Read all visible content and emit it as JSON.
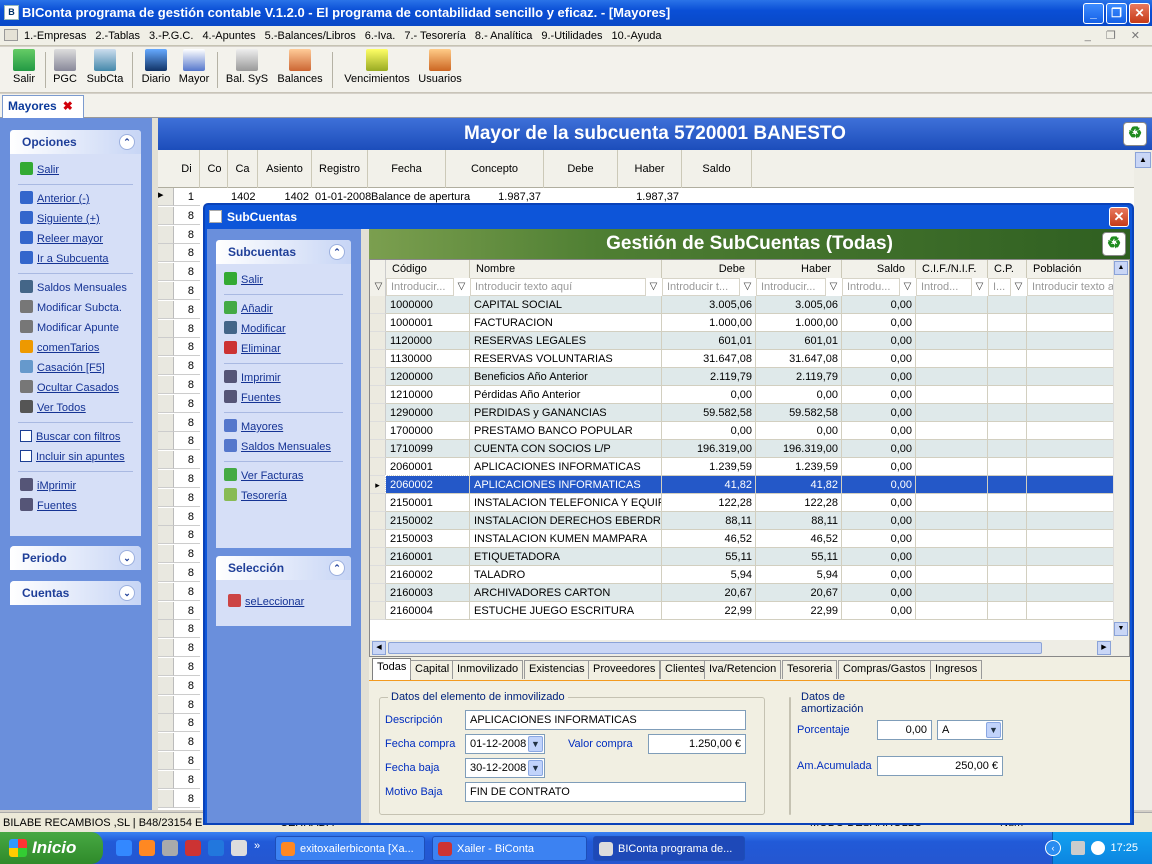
{
  "window": {
    "title": "BIConta programa de gestión contable V.1.2.0 - El programa de contabilidad sencillo y eficaz. - [Mayores]"
  },
  "menu": [
    "1.-Empresas",
    "2.-Tablas",
    "3.-P.G.C.",
    "4.-Apuntes",
    "5.-Balances/Libros",
    "6.-Iva.",
    "7.- Tesorería",
    "8.- Analítica",
    "9.-Utilidades",
    "10.-Ayuda"
  ],
  "toolbar": {
    "salir": "Salir",
    "pgc": "PGC",
    "subcta": "SubCta",
    "diario": "Diario",
    "mayor": "Mayor",
    "balsys": "Bal. SyS",
    "balances": "Balances",
    "vencimientos": "Vencimientos",
    "usuarios": "Usuarios"
  },
  "doc_tab": {
    "label": "Mayores"
  },
  "left": {
    "opciones": {
      "title": "Opciones",
      "items": [
        "Salir",
        "Anterior (-)",
        "Siguiente (+)",
        "Releer mayor",
        "Ir a Subcuenta",
        "Saldos Mensuales",
        "Modificar Subcta.",
        "Modificar Apunte",
        "comenTarios",
        "Casación [F5]",
        "Ocultar Casados",
        "Ver Todos",
        "Buscar con filtros",
        "Incluir sin apuntes",
        "iMprimir",
        "Fuentes"
      ]
    },
    "periodo": {
      "title": "Periodo"
    },
    "cuentas": {
      "title": "Cuentas"
    }
  },
  "mayor": {
    "title": "Mayor de la subcuenta 5720001 BANESTO",
    "columns": [
      "Di",
      "Co",
      "Ca",
      "Asiento",
      "Registro",
      "Fecha",
      "Concepto",
      "Debe",
      "Haber",
      "Saldo"
    ],
    "first_row": {
      "di": "1",
      "asiento": "1402",
      "registro": "1402",
      "fecha": "01-01-2008",
      "concepto": "Balance de apertura",
      "debe": "1.987,37",
      "saldo": "1.987,37"
    },
    "other_di": "8"
  },
  "dialog": {
    "title": "SubCuentas",
    "side": {
      "subcuentas": {
        "title": "Subcuentas",
        "items": [
          "Salir",
          "Añadir",
          "Modificar",
          "Eliminar",
          "Imprimir",
          "Fuentes",
          "Mayores",
          "Saldos Mensuales",
          "Ver Facturas",
          "Tesorería"
        ]
      },
      "seleccion": {
        "title": "Selección",
        "items": [
          "seLeccionar"
        ]
      }
    },
    "grid_title": "Gestión de SubCuentas (Todas)",
    "columns": [
      "Código",
      "Nombre",
      "Debe",
      "Haber",
      "Saldo",
      "C.I.F./N.I.F.",
      "C.P.",
      "Población"
    ],
    "filters": [
      "Introducir...",
      "Introducir texto aquí",
      "Introducir t...",
      "Introducir...",
      "Introdu...",
      "Introd...",
      "I...",
      "Introducir texto aq"
    ],
    "rows": [
      [
        "1000000",
        "CAPITAL SOCIAL",
        "3.005,06",
        "3.005,06",
        "0,00"
      ],
      [
        "1000001",
        "FACTURACION",
        "1.000,00",
        "1.000,00",
        "0,00"
      ],
      [
        "1120000",
        "RESERVAS LEGALES",
        "601,01",
        "601,01",
        "0,00"
      ],
      [
        "1130000",
        "RESERVAS VOLUNTARIAS",
        "31.647,08",
        "31.647,08",
        "0,00"
      ],
      [
        "1200000",
        "Beneficios Año Anterior",
        "2.119,79",
        "2.119,79",
        "0,00"
      ],
      [
        "1210000",
        "Pérdidas Año Anterior",
        "0,00",
        "0,00",
        "0,00"
      ],
      [
        "1290000",
        "PERDIDAS y GANANCIAS",
        "59.582,58",
        "59.582,58",
        "0,00"
      ],
      [
        "1700000",
        "PRESTAMO BANCO POPULAR",
        "0,00",
        "0,00",
        "0,00"
      ],
      [
        "1710099",
        "CUENTA CON SOCIOS L/P",
        "196.319,00",
        "196.319,00",
        "0,00"
      ],
      [
        "2060001",
        "APLICACIONES INFORMATICAS",
        "1.239,59",
        "1.239,59",
        "0,00"
      ],
      [
        "2060002",
        "APLICACIONES INFORMATICAS",
        "41,82",
        "41,82",
        "0,00"
      ],
      [
        "2150001",
        "INSTALACION TELEFONICA Y EQUIF",
        "122,28",
        "122,28",
        "0,00"
      ],
      [
        "2150002",
        "INSTALACION DERECHOS EBERDRI",
        "88,11",
        "88,11",
        "0,00"
      ],
      [
        "2150003",
        "INSTALACION KUMEN MAMPARA",
        "46,52",
        "46,52",
        "0,00"
      ],
      [
        "2160001",
        "ETIQUETADORA",
        "55,11",
        "55,11",
        "0,00"
      ],
      [
        "2160002",
        "TALADRO",
        "5,94",
        "5,94",
        "0,00"
      ],
      [
        "2160003",
        "ARCHIVADORES CARTON",
        "20,67",
        "20,67",
        "0,00"
      ],
      [
        "2160004",
        "ESTUCHE JUEGO ESCRITURA",
        "22,99",
        "22,99",
        "0,00"
      ]
    ],
    "selected_index": 10,
    "tabs": [
      "Todas",
      "Capital",
      "Inmovilizado",
      "Existencias",
      "Proveedores",
      "Clientes",
      "Iva/Retencion",
      "Tesoreria",
      "Compras/Gastos",
      "Ingresos"
    ],
    "form": {
      "inmov_legend": "Datos del elemento de inmovilizado",
      "descripcion_label": "Descripción",
      "descripcion": "APLICACIONES INFORMATICAS",
      "fecha_compra_label": "Fecha compra",
      "fecha_compra": "01-12-2008",
      "valor_compra_label": "Valor compra",
      "valor_compra": "1.250,00 €",
      "fecha_baja_label": "Fecha baja",
      "fecha_baja": "30-12-2008",
      "motivo_label": "Motivo Baja",
      "motivo": "FIN DE CONTRATO",
      "amort_legend": "Datos de amortización",
      "porcentaje_label": "Porcentaje",
      "porcentaje": "0,00",
      "tipo": "A",
      "acumulada_label": "Am.Acumulada",
      "acumulada": "250,00 €"
    }
  },
  "status": {
    "text": "BILABE RECAMBIOS ,SL | B48/23154   E",
    "right1": "CERRADA",
    "right2": "MODO DESARROLLO",
    "right3": "Num"
  },
  "taskbar": {
    "start": "Inicio",
    "tasks": [
      "exitoxailerbiconta [Xa...",
      "Xailer - BiConta",
      "BIConta programa de..."
    ],
    "clock": "17:25"
  }
}
